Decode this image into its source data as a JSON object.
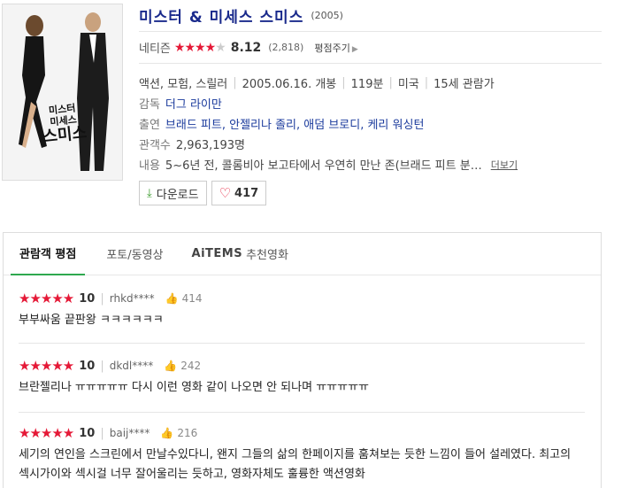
{
  "movie": {
    "title": "미스터 & 미세스 스미스",
    "year": "(2005)",
    "rating_label": "네티즌",
    "rating_stars": 4,
    "score": "8.12",
    "rating_count": "(2,818)",
    "rate_link": "평점주기",
    "genre": "액션, 모험, 스릴러",
    "release": "2005.06.16. 개봉",
    "runtime": "119분",
    "country": "미국",
    "age": "15세 관람가",
    "director_label": "감독",
    "director": "더그 라이만",
    "cast_label": "출연",
    "cast": "브래드 피트, 안젤리나 졸리, 애덤 브로디, 케리 워싱턴",
    "audience_label": "관객수",
    "audience": "2,963,193명",
    "synopsis_label": "내용",
    "synopsis": "5~6년 전, 콜롬비아 보고타에서 우연히 만난 존(브래드 피트 분…",
    "more": "더보기",
    "poster_title_line1": "미스터",
    "poster_title_line2": "미세스",
    "poster_title_big": "스미스"
  },
  "actions": {
    "download_label": "다운로드",
    "like_count": "417"
  },
  "tabs": [
    {
      "label": "관람객 평점"
    },
    {
      "label": "포토/동영상"
    },
    {
      "prefix": "AiTEMS",
      "label": "추천영화"
    }
  ],
  "reviews": [
    {
      "score": "10",
      "user": "rhkd****",
      "likes": "414",
      "text": "부부싸움 끝판왕 ㅋㅋㅋㅋㅋㅋ"
    },
    {
      "score": "10",
      "user": "dkdl****",
      "likes": "242",
      "text": "브란젤리나 ㅠㅠㅠㅠㅠ 다시 이런 영화 같이 나오면 안 되나며 ㅠㅠㅠㅠㅠ"
    },
    {
      "score": "10",
      "user": "baij****",
      "likes": "216",
      "text": "세기의 연인을 스크린에서 만날수있다니, 왠지 그들의 삶의 한페이지를 훔쳐보는 듯한 느낌이 들어 설레였다. 최고의 섹시가이와 섹시걸 너무 잘어울리는 듯하고, 영화자체도 훌륭한 액션영화"
    }
  ],
  "colors": {
    "title": "#1a2a8c",
    "star": "#e51937",
    "tab_underline": "#2fa84f",
    "download_icon": "#3a9b2c"
  }
}
